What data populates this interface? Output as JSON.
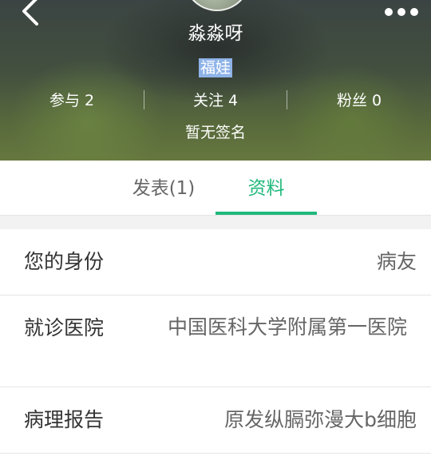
{
  "header": {
    "nickname": "淼淼呀",
    "badge": "福娃",
    "stats": [
      {
        "label": "参与",
        "value": "2"
      },
      {
        "label": "关注",
        "value": "4"
      },
      {
        "label": "粉丝",
        "value": "0"
      }
    ],
    "signature": "暂无签名",
    "back_icon": "chevron-left-icon",
    "more_icon": "more-dots-icon"
  },
  "tabs": [
    {
      "label": "发表(1)",
      "active": false
    },
    {
      "label": "资料",
      "active": true
    }
  ],
  "profile": {
    "rows": [
      {
        "label": "您的身份",
        "value": "病友"
      },
      {
        "label": "就诊医院",
        "value": "中国医科大学附属第一医院"
      },
      {
        "label": "病理报告",
        "value": "原发纵膈弥漫大b细胞"
      }
    ]
  },
  "colors": {
    "accent": "#20b97b",
    "badge_bg": "#8fb3e8",
    "divider": "#e6e6e6",
    "gap_bg": "#f2f2f2"
  }
}
